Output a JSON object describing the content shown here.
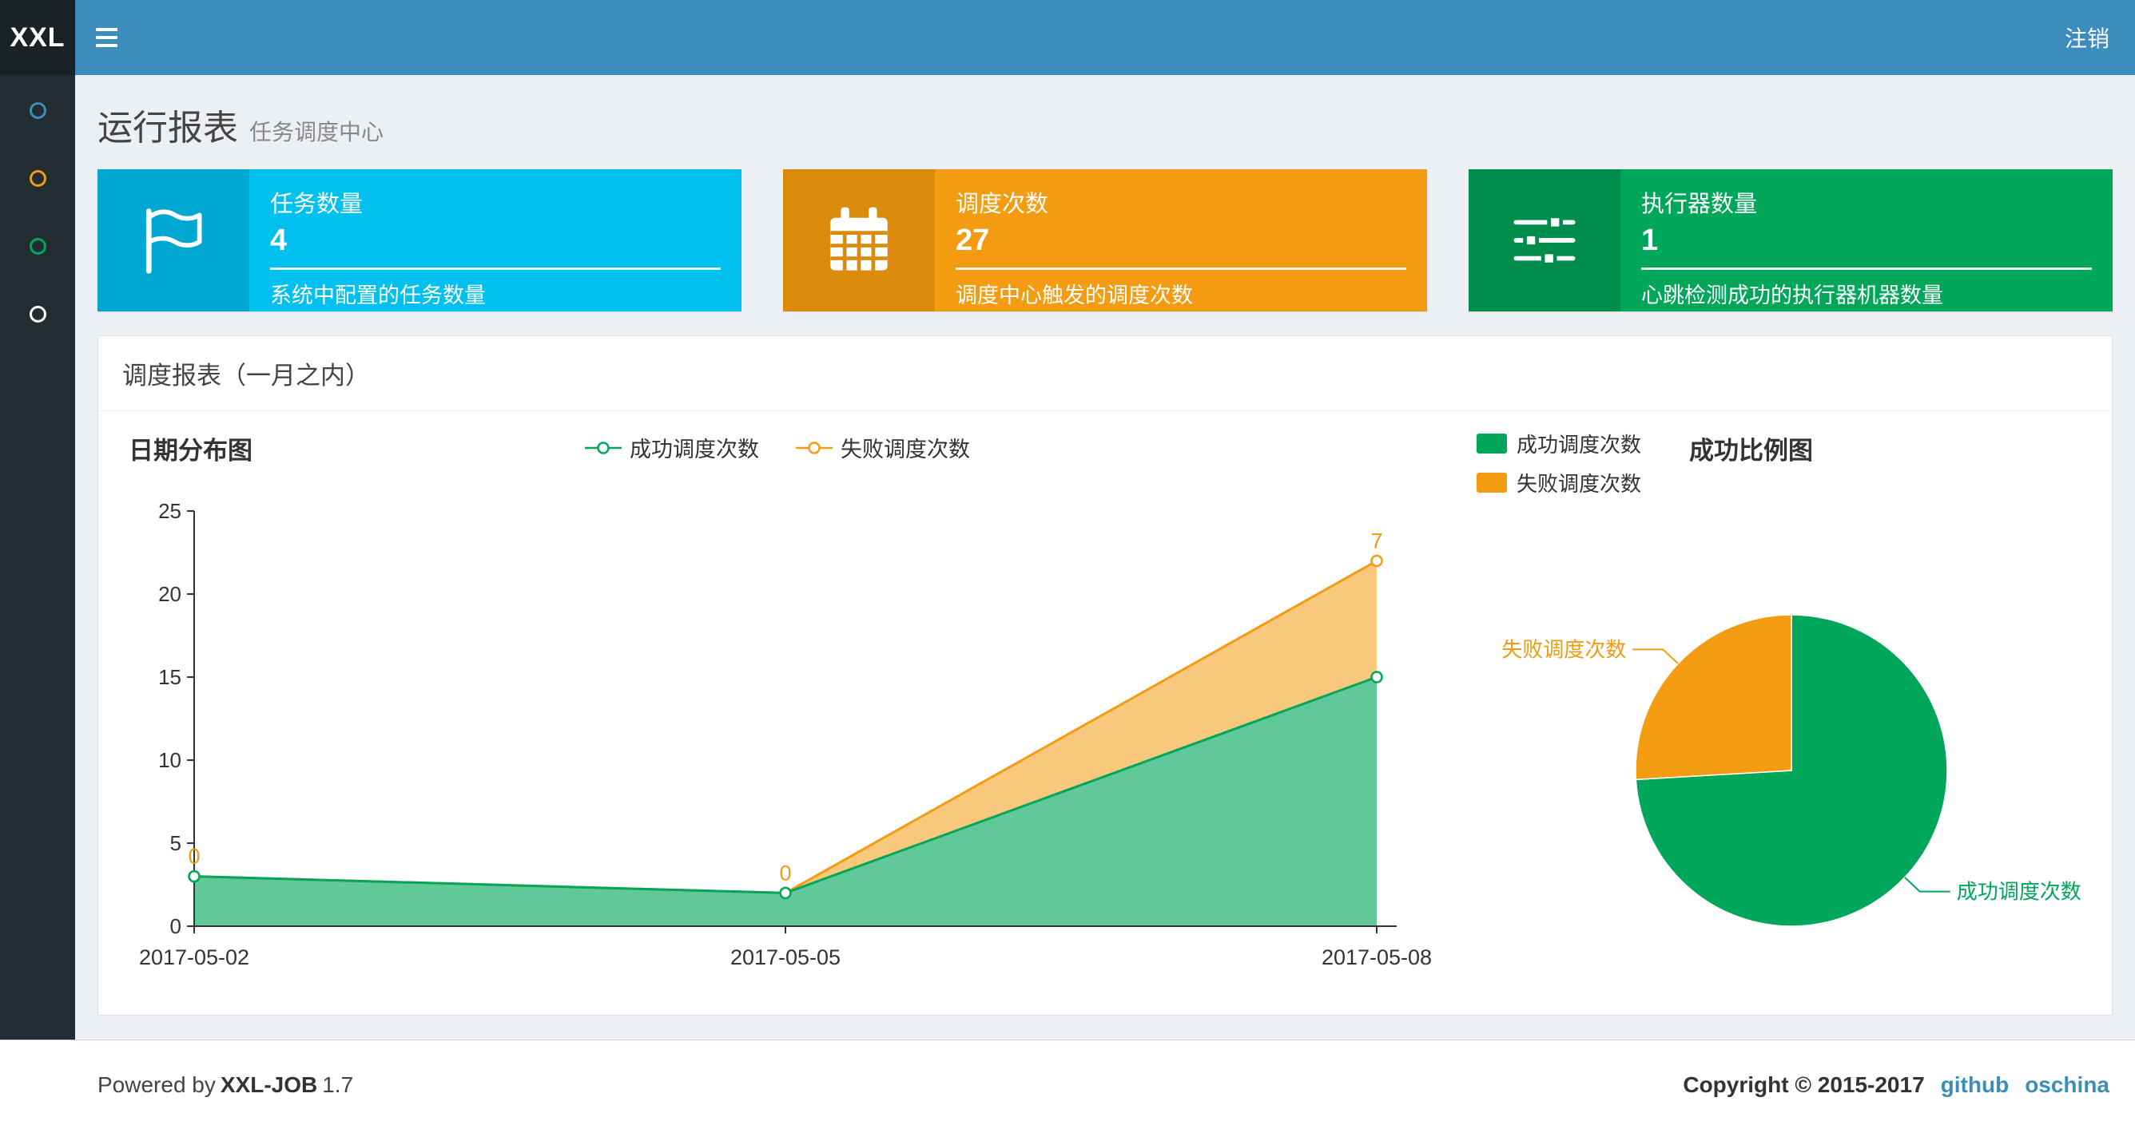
{
  "navbar": {
    "logo": "XXL",
    "logout": "注销",
    "bg_color": "#3c8dbc",
    "logo_bg_color": "#1a2226"
  },
  "sidebar": {
    "bg_color": "#222d32",
    "items": [
      {
        "name": "menu-dot-1",
        "color": "#3c8dbc"
      },
      {
        "name": "menu-dot-2",
        "color": "#f39c12"
      },
      {
        "name": "menu-dot-3",
        "color": "#00a65a"
      },
      {
        "name": "menu-dot-4",
        "color": "#ffffff"
      }
    ]
  },
  "page": {
    "title": "运行报表",
    "subtitle": "任务调度中心"
  },
  "info_boxes": [
    {
      "icon": "flag-icon",
      "title": "任务数量",
      "value": "4",
      "desc": "系统中配置的任务数量",
      "color": "#00c0ef",
      "icon_bg": "#00a7d0"
    },
    {
      "icon": "calendar-icon",
      "title": "调度次数",
      "value": "27",
      "desc": "调度中心触发的调度次数",
      "color": "#f39c12",
      "icon_bg": "#db8b0b"
    },
    {
      "icon": "sliders-icon",
      "title": "执行器数量",
      "value": "1",
      "desc": "心跳检测成功的执行器机器数量",
      "color": "#00a65a",
      "icon_bg": "#008d4c"
    }
  ],
  "panel": {
    "title": "调度报表（一月之内）"
  },
  "chart_data": [
    {
      "type": "area",
      "title": "日期分布图",
      "stacked": true,
      "x": [
        "2017-05-02",
        "2017-05-05",
        "2017-05-08"
      ],
      "series": [
        {
          "name": "成功调度次数",
          "color": "#00a65a",
          "values": [
            3,
            2,
            15
          ]
        },
        {
          "name": "失败调度次数",
          "color": "#f39c12",
          "values": [
            0,
            0,
            7
          ],
          "point_labels": [
            "0",
            "0",
            "7"
          ]
        }
      ],
      "ylim": [
        0,
        25
      ],
      "yticks": [
        0,
        5,
        10,
        15,
        20,
        25
      ],
      "grid": false,
      "legend_position": "top-center"
    },
    {
      "type": "pie",
      "title": "成功比例图",
      "legend_position": "top-left",
      "slices": [
        {
          "name": "成功调度次数",
          "value": 20,
          "color": "#00a65a"
        },
        {
          "name": "失败调度次数",
          "value": 7,
          "color": "#f39c12"
        }
      ]
    }
  ],
  "footer": {
    "powered_by": "Powered by",
    "product": "XXL-JOB",
    "version": "1.7",
    "copyright": "Copyright © 2015-2017",
    "links": [
      {
        "label": "github"
      },
      {
        "label": "oschina"
      }
    ],
    "link_color": "#3c8dbc"
  }
}
